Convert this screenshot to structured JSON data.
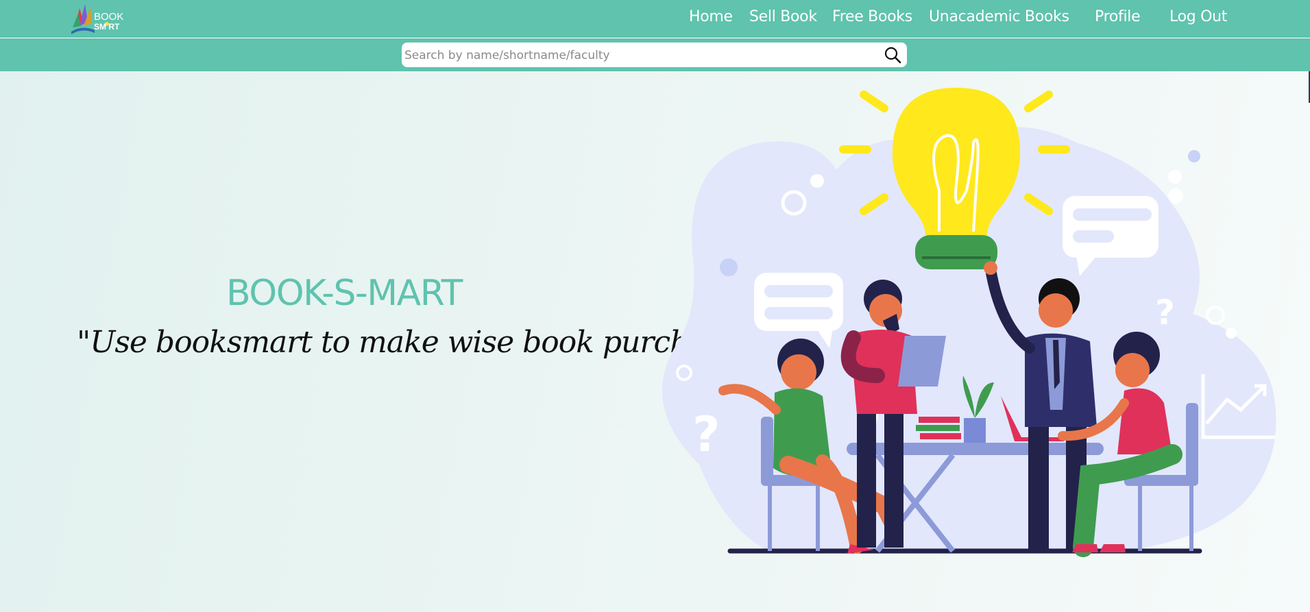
{
  "header": {
    "logo": {
      "line1": "BOOK",
      "line2": "SM RT"
    },
    "nav": [
      {
        "label": "Home"
      },
      {
        "label": "Sell Book"
      },
      {
        "label": "Free Books"
      },
      {
        "label": "Unacademic Books"
      },
      {
        "label": "Profile"
      },
      {
        "label": "Log Out"
      }
    ]
  },
  "search": {
    "placeholder": "Search by name/shortname/faculty",
    "value": "",
    "icon": "search-icon"
  },
  "hero": {
    "title": "BOOK-S-MART",
    "quote": "\"Use booksmart to make wise book purchases. \""
  },
  "colors": {
    "brand": "#5fc3ae",
    "bulb": "#ffe81c",
    "blob": "#e2e7fb",
    "navy": "#23224a"
  },
  "illustration": "people-meeting-lightbulb-illustration"
}
